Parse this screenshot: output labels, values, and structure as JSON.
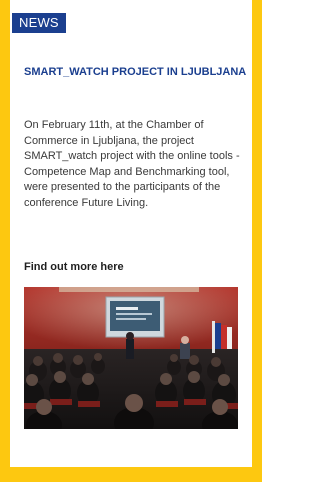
{
  "badge": {
    "label": "NEWS",
    "color": "#1b3f8f"
  },
  "article": {
    "title": "SMART_WATCH PROJECT IN LJUBLJANA",
    "body": "On February 11th, at the Chamber of Commerce in Ljubljana, the project SMART_watch project with the online tools - Competence Map and Benchmarking tool, were presented to the participants of the conference Future Living.",
    "link_label": "Find out more here"
  },
  "image": {
    "description_icon": "conference-photo"
  },
  "colors": {
    "frame": "#fdc810",
    "title": "#1b3f8f",
    "text": "#3a3a3a"
  }
}
